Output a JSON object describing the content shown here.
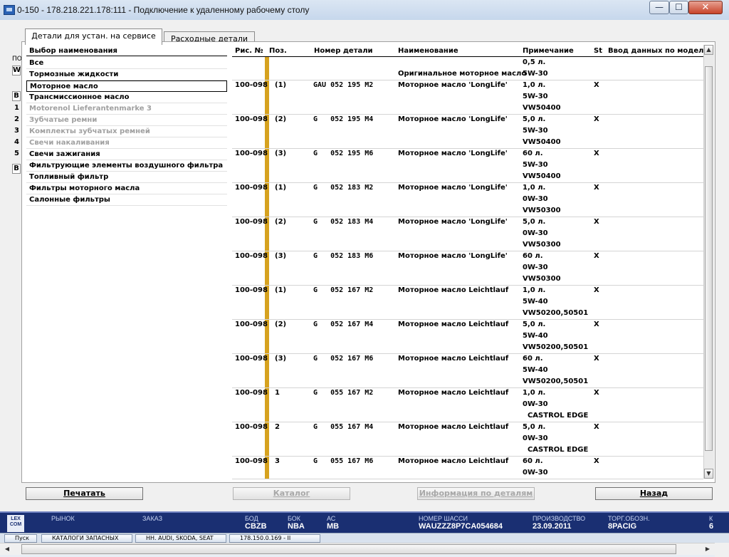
{
  "window": {
    "title": "0-150 - 178.218.221.178:111 - Подключение к удаленному рабочему столу",
    "min_glyph": "—",
    "max_glyph": "☐",
    "close_glyph": "✕"
  },
  "left_strip": {
    "top_label": "ПО",
    "field": "W",
    "cells": [
      "B",
      "1",
      "2",
      "3",
      "4",
      "5",
      "B"
    ]
  },
  "tabs": {
    "active": "Детали для устан. на сервисе",
    "inactive": "Расходные детали"
  },
  "categories": {
    "header": "Выбор наименования",
    "items": [
      {
        "label": "Все",
        "state": "normal"
      },
      {
        "label": "Тормозные жидкости",
        "state": "normal"
      },
      {
        "label": "Моторное масло",
        "state": "selected"
      },
      {
        "label": "Трансмиссионное масло",
        "state": "normal"
      },
      {
        "label": "Motorenol Lieferantenmarke 3",
        "state": "disabled"
      },
      {
        "label": "Зубчатые ремни",
        "state": "disabled"
      },
      {
        "label": "Комплекты зубчатых ремней",
        "state": "disabled"
      },
      {
        "label": "Свечи накаливания",
        "state": "disabled"
      },
      {
        "label": "Свечи зажигания",
        "state": "normal"
      },
      {
        "label": "Фильтрующие элементы воздушного фильтра",
        "state": "normal"
      },
      {
        "label": "Топливный фильтр",
        "state": "normal"
      },
      {
        "label": "Фильтры моторного масла",
        "state": "normal"
      },
      {
        "label": "Салонные фильтры",
        "state": "normal"
      }
    ]
  },
  "table": {
    "headers": {
      "fig": "Рис. №",
      "pos": "Поз.",
      "part": "Номер детали",
      "name": "Наименование",
      "note": "Примечание",
      "st": "St",
      "model": "Ввод данных по модели"
    },
    "rows": [
      {
        "fig": "",
        "pos": "",
        "part": "",
        "name": "Оригинальное моторное масло",
        "name_line": 2,
        "notes": [
          "0,5 л.",
          "5W-30"
        ],
        "st": ""
      },
      {
        "fig": "100-098",
        "pos": "(1)",
        "part": "GAU 052 195 M2",
        "name": "Моторное масло 'LongLife'",
        "name_line": 1,
        "notes": [
          "1,0 л.",
          "5W-30",
          "VW50400"
        ],
        "st": "X"
      },
      {
        "fig": "100-098",
        "pos": "(2)",
        "part": "G   052 195 M4",
        "name": "Моторное масло 'LongLife'",
        "name_line": 1,
        "notes": [
          "5,0 л.",
          "5W-30",
          "VW50400"
        ],
        "st": "X"
      },
      {
        "fig": "100-098",
        "pos": "(3)",
        "part": "G   052 195 M6",
        "name": "Моторное масло 'LongLife'",
        "name_line": 1,
        "notes": [
          "60 л.",
          "5W-30",
          "VW50400"
        ],
        "st": "X"
      },
      {
        "fig": "100-098",
        "pos": "(1)",
        "part": "G   052 183 M2",
        "name": "Моторное масло 'LongLife'",
        "name_line": 1,
        "notes": [
          "1,0 л.",
          "0W-30",
          "VW50300"
        ],
        "st": "X"
      },
      {
        "fig": "100-098",
        "pos": "(2)",
        "part": "G   052 183 M4",
        "name": "Моторное масло 'LongLife'",
        "name_line": 1,
        "notes": [
          "5,0 л.",
          "0W-30",
          "VW50300"
        ],
        "st": "X"
      },
      {
        "fig": "100-098",
        "pos": "(3)",
        "part": "G   052 183 M6",
        "name": "Моторное масло 'LongLife'",
        "name_line": 1,
        "notes": [
          "60 л.",
          "0W-30",
          "VW50300"
        ],
        "st": "X"
      },
      {
        "fig": "100-098",
        "pos": "(1)",
        "part": "G   052 167 M2",
        "name": "Моторное масло Leichtlauf",
        "name_line": 1,
        "notes": [
          "1,0 л.",
          "5W-40",
          "VW50200,50501"
        ],
        "st": "X"
      },
      {
        "fig": "100-098",
        "pos": "(2)",
        "part": "G   052 167 M4",
        "name": "Моторное масло Leichtlauf",
        "name_line": 1,
        "notes": [
          "5,0 л.",
          "5W-40",
          "VW50200,50501"
        ],
        "st": "X"
      },
      {
        "fig": "100-098",
        "pos": "(3)",
        "part": "G   052 167 M6",
        "name": "Моторное масло Leichtlauf",
        "name_line": 1,
        "notes": [
          "60 л.",
          "5W-40",
          "VW50200,50501"
        ],
        "st": "X"
      },
      {
        "fig": "100-098",
        "pos": "1",
        "part": "G   055 167 M2",
        "name": "Моторное масло Leichtlauf",
        "name_line": 1,
        "notes": [
          "1,0 л.",
          "0W-30",
          "  CASTROL EDGE"
        ],
        "st": "X"
      },
      {
        "fig": "100-098",
        "pos": "2",
        "part": "G   055 167 M4",
        "name": "Моторное масло Leichtlauf",
        "name_line": 1,
        "notes": [
          "5,0 л.",
          "0W-30",
          "  CASTROL EDGE"
        ],
        "st": "X"
      },
      {
        "fig": "100-098",
        "pos": "3",
        "part": "G   055 167 M6",
        "name": "Моторное масло Leichtlauf",
        "name_line": 1,
        "notes": [
          "60 л.",
          "0W-30"
        ],
        "st": "X"
      }
    ]
  },
  "buttons": {
    "print": "Печатать",
    "catalog": "Каталог",
    "info": "Информация по деталям",
    "back": "Назад"
  },
  "statusbar": {
    "logo": "LEX COM",
    "fields": [
      {
        "label": "РЫНОК",
        "value": ""
      },
      {
        "label": "ЗАКАЗ",
        "value": ""
      },
      {
        "label": "БОД",
        "value": "CBZB"
      },
      {
        "label": "БОК",
        "value": "NBA"
      },
      {
        "label": "АС",
        "value": "MB"
      },
      {
        "label": "НОМЕР ШАССИ",
        "value": "WAUZZZ8P7CA054684"
      },
      {
        "label": "ПРОИЗВОДСТВО",
        "value": "23.09.2011"
      },
      {
        "label": "ТОРГ.ОБОЗН.",
        "value": "8PACIG"
      },
      {
        "label": "К",
        "value": "6"
      }
    ]
  },
  "taskbar": {
    "items": [
      "Пуск",
      "КАТАЛОГИ ЗАПАСНЫХ",
      "НН. AUDI, SKODA, SEAT",
      "178.150.0.169 - II"
    ]
  },
  "colors": {
    "accent_bar": "#d6a21f",
    "statusbar_bg": "#1a2f72"
  }
}
